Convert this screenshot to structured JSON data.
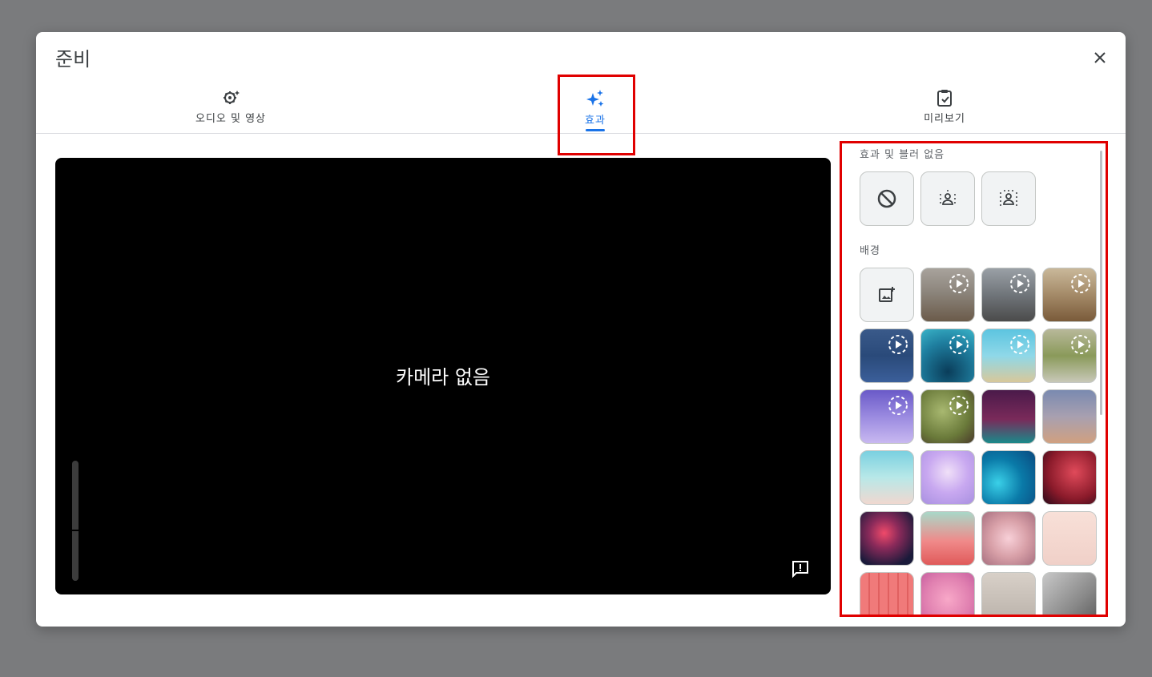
{
  "dialog": {
    "title": "준비"
  },
  "tabs": [
    {
      "label": "오디오 및 영상",
      "icon": "audio-video-settings-icon",
      "active": false
    },
    {
      "label": "효과",
      "icon": "sparkle-icon",
      "active": true
    },
    {
      "label": "미리보기",
      "icon": "clipboard-check-icon",
      "active": false
    }
  ],
  "preview": {
    "no_camera_text": "카메라 없음"
  },
  "effects": {
    "no_effect_label": "효과 및 블러 없음",
    "background_label": "배경"
  },
  "colors": {
    "accent": "#1a73e8",
    "highlight": "#e00000"
  }
}
